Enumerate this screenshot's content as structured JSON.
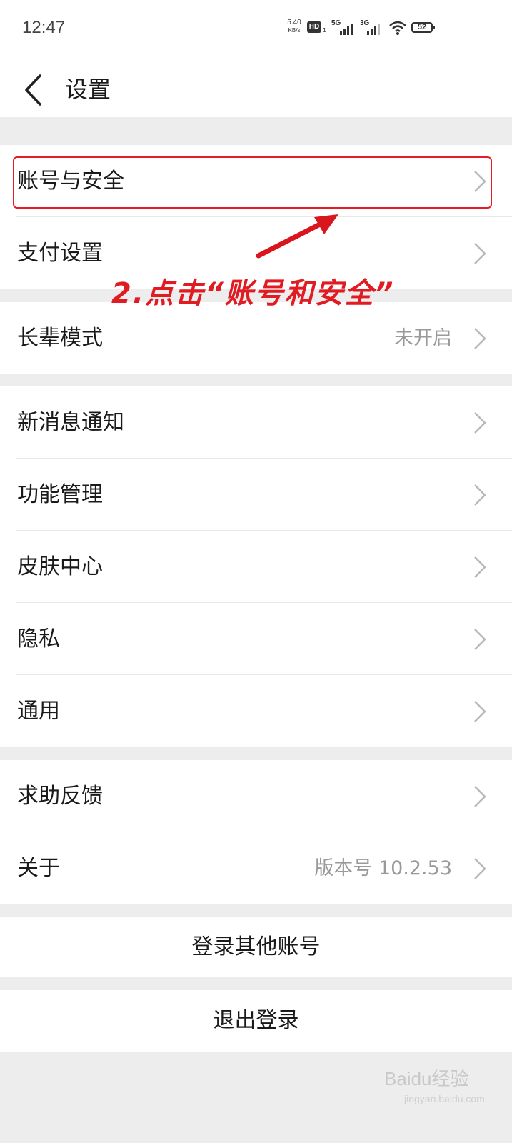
{
  "status_bar": {
    "time": "12:47",
    "net_speed": "5.40",
    "net_speed_unit": "KB/s",
    "hd": "HD",
    "hd_sub": "1",
    "sim1": "5G",
    "sim2": "3G",
    "battery": "52"
  },
  "header": {
    "title": "设置"
  },
  "groups": {
    "account": {
      "rows": [
        {
          "label": "账号与安全"
        },
        {
          "label": "支付设置"
        }
      ]
    },
    "elder": {
      "rows": [
        {
          "label": "长辈模式",
          "value": "未开启"
        }
      ]
    },
    "general": {
      "rows": [
        {
          "label": "新消息通知"
        },
        {
          "label": "功能管理"
        },
        {
          "label": "皮肤中心"
        },
        {
          "label": "隐私"
        },
        {
          "label": "通用"
        }
      ]
    },
    "help": {
      "rows": [
        {
          "label": "求助反馈"
        },
        {
          "label": "关于",
          "value": "版本号 10.2.53"
        }
      ]
    }
  },
  "actions": {
    "switch_account": "登录其他账号",
    "logout": "退出登录"
  },
  "annotation": {
    "text": "2.点击“账号和安全”",
    "color": "#e01b22"
  },
  "watermark": {
    "text": "Baidu经验",
    "sub": "jingyan.baidu.com"
  }
}
